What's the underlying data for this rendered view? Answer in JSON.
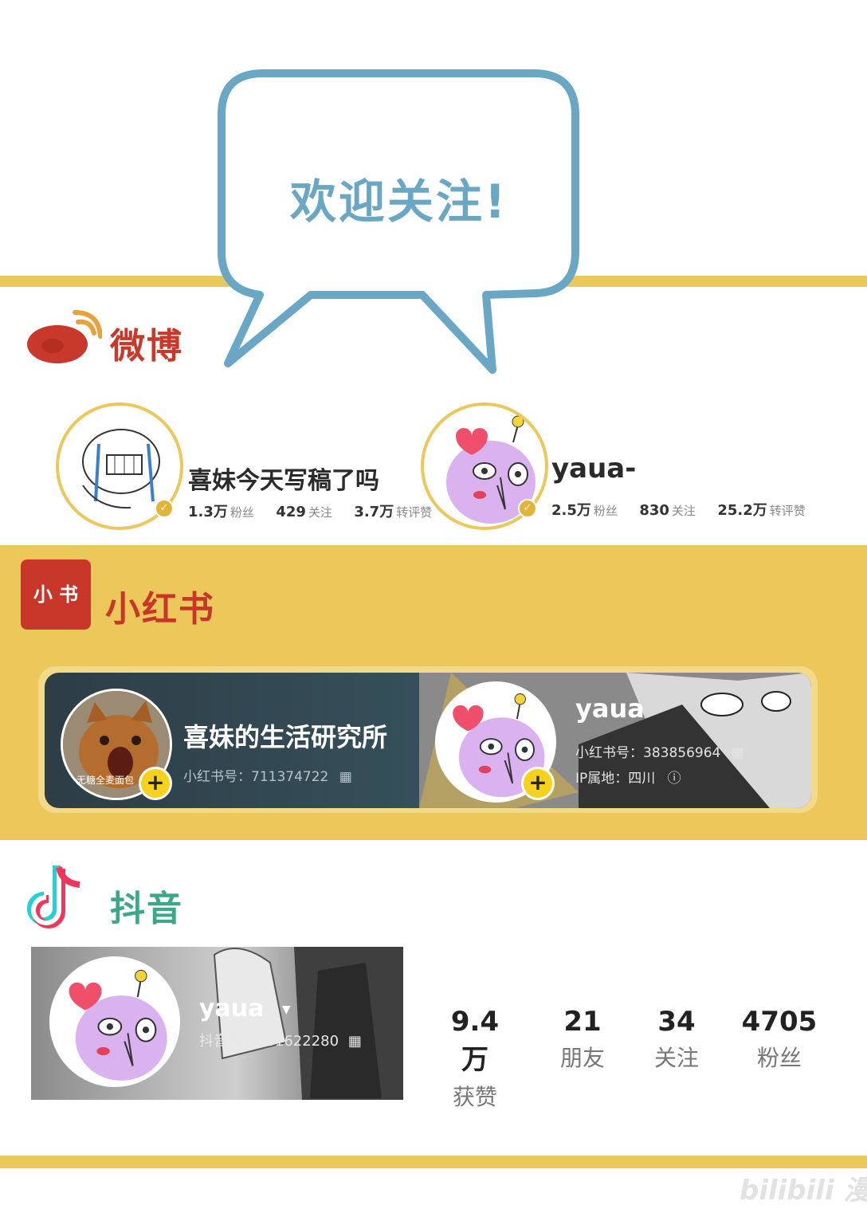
{
  "bubble": {
    "text": "欢迎关注!"
  },
  "weibo": {
    "title": "微博",
    "accounts": [
      {
        "name": "喜妹今天写稿了吗",
        "followers": "1.3万",
        "followers_label": "粉丝",
        "following": "429",
        "following_label": "关注",
        "reposts": "3.7万",
        "reposts_label": "转评赞"
      },
      {
        "name": "yaua-",
        "followers": "2.5万",
        "followers_label": "粉丝",
        "following": "830",
        "following_label": "关注",
        "reposts": "25.2万",
        "reposts_label": "转评赞"
      }
    ]
  },
  "xiaohongshu": {
    "logo_text": "小 书",
    "title": "小红书",
    "accounts": [
      {
        "name": "喜妹的生活研究所",
        "id_line": "小红书号：711374722",
        "avatar_caption": "无糖全麦面包"
      },
      {
        "name": "yaua",
        "id_line": "小红书号：383856964",
        "ip_line": "IP属地：四川"
      }
    ]
  },
  "douyin": {
    "title": "抖音",
    "account": {
      "name": "yaua",
      "id_line": "抖音号：631622280"
    },
    "stats": [
      {
        "value": "9.4万",
        "label": "获赞"
      },
      {
        "value": "21",
        "label": "朋友"
      },
      {
        "value": "34",
        "label": "关注"
      },
      {
        "value": "4705",
        "label": "粉丝"
      }
    ]
  },
  "colors": {
    "accent_yellow": "#ecc75a",
    "bubble_stroke": "#6aa7c4",
    "bubble_text": "#6aa7c4",
    "weibo_red": "#c9392b",
    "xhs_red": "#c8362a",
    "douyin_green": "#3aa889"
  },
  "watermark": {
    "text": "bilibili 漫画"
  }
}
